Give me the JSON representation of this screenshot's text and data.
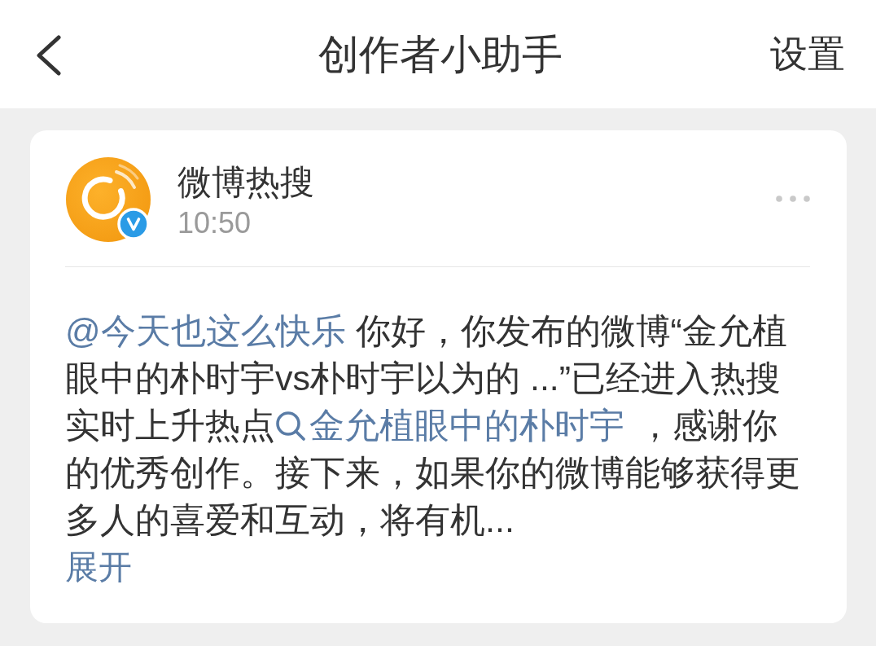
{
  "header": {
    "title": "创作者小助手",
    "action": "设置"
  },
  "message": {
    "sender": "微博热搜",
    "time": "10:50",
    "verified": true,
    "body": [
      {
        "kind": "mention",
        "text": "@今天也这么快乐"
      },
      {
        "kind": "text",
        "text": " 你好，你发布的微博“金允植眼中的朴时宇vs朴时宇以为的 ...”已经进入热搜实时上升热点"
      },
      {
        "kind": "topic",
        "text": "金允植眼中的朴时宇"
      },
      {
        "kind": "text",
        "text": " ，感谢你的优秀创作。接下来，如果你的微博能够获得更多人的喜爱和互动，将有机..."
      }
    ],
    "expand": "展开"
  }
}
